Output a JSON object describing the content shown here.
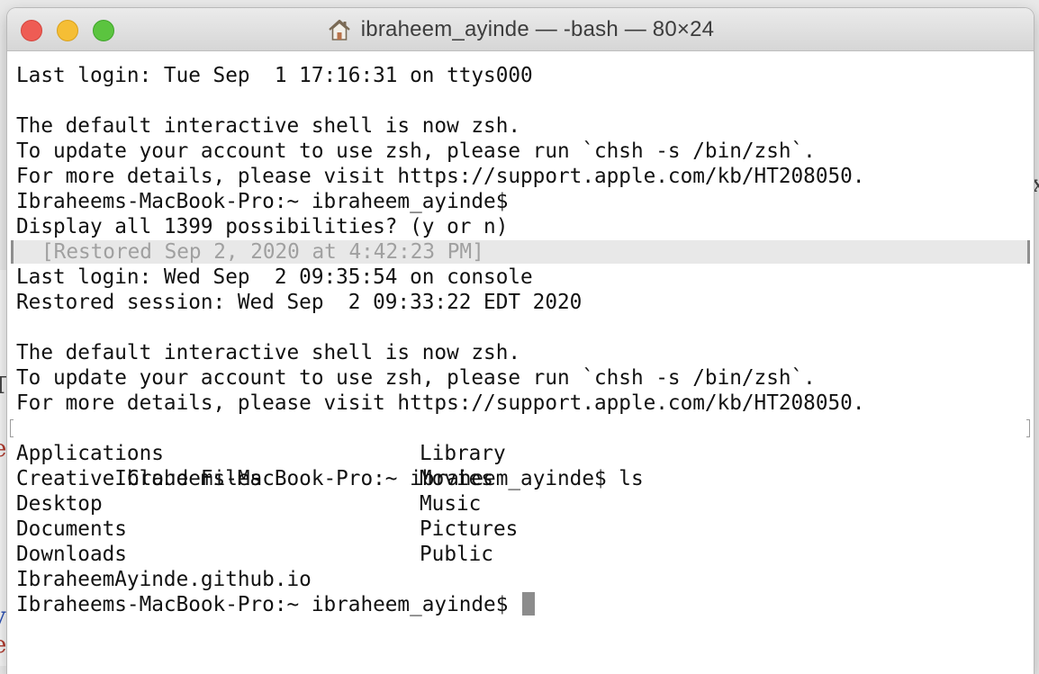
{
  "window": {
    "title": "ibraheem_ayinde — -bash — 80×24",
    "home_icon": "home-icon",
    "buttons": [
      "close-button",
      "minimize-button",
      "zoom-button"
    ]
  },
  "terminal": {
    "line1": "Last login: Tue Sep  1 17:16:31 on ttys000",
    "line3": "The default interactive shell is now zsh.",
    "line4": "To update your account to use zsh, please run `chsh -s /bin/zsh`.",
    "line5": "For more details, please visit https://support.apple.com/kb/HT208050.",
    "line6": "Ibraheems-MacBook-Pro:~ ibraheem_ayinde$",
    "line7": "Display all 1399 possibilities? (y or n)",
    "restored_marker": "[Restored Sep 2, 2020 at 4:42:23 PM]",
    "line9": "Last login: Wed Sep  2 09:35:54 on console",
    "line10": "Restored session: Wed Sep  2 09:33:22 EDT 2020",
    "line12": "The default interactive shell is now zsh.",
    "line13": "To update your account to use zsh, please run `chsh -s /bin/zsh`.",
    "line14": "For more details, please visit https://support.apple.com/kb/HT208050.",
    "line15": "Ibraheems-MacBook-Pro:~ ibraheem_ayinde$ ls",
    "ls_output": [
      {
        "left": "Applications",
        "right": "Library"
      },
      {
        "left": "Creative Cloud Files",
        "right": "Movies"
      },
      {
        "left": "Desktop",
        "right": "Music"
      },
      {
        "left": "Documents",
        "right": "Pictures"
      },
      {
        "left": "Downloads",
        "right": "Public"
      },
      {
        "left": "IbraheemAyinde.github.io",
        "right": ""
      }
    ],
    "prompt": "Ibraheems-MacBook-Pro:~ ibraheem_ayinde$ "
  },
  "background": {
    "fragment_1": "T",
    "fragment_2": "e",
    "fragment_3": "y",
    "fragment_4": "e",
    "fragment_5": "x"
  },
  "colors": {
    "close": "#ee5c54",
    "minimize": "#f5be35",
    "zoom": "#5bc43f",
    "restored_text": "#a0a0a0"
  }
}
